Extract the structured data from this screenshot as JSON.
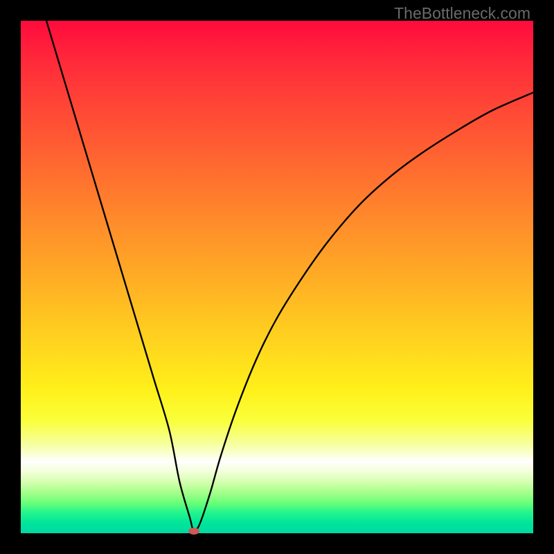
{
  "watermark": "TheBottleneck.com",
  "chart_data": {
    "type": "line",
    "title": "",
    "xlabel": "",
    "ylabel": "",
    "xlim": [
      0,
      100
    ],
    "ylim": [
      0,
      100
    ],
    "grid": false,
    "legend": false,
    "series": [
      {
        "name": "curve",
        "color": "#000000",
        "x": [
          5,
          8,
          11,
          14,
          17,
          20,
          23,
          26,
          29,
          31,
          33,
          33.5,
          34,
          35,
          37,
          39,
          42,
          46,
          50,
          55,
          60,
          66,
          72,
          78,
          85,
          92,
          100
        ],
        "y": [
          100,
          90,
          80,
          70,
          60,
          50,
          40,
          30,
          20,
          10,
          3,
          1,
          0.5,
          2,
          8,
          15,
          24,
          34,
          42,
          50,
          57,
          64,
          69.5,
          74,
          78.5,
          82.5,
          86
        ]
      }
    ],
    "marker": {
      "x": 33.8,
      "y": 0.4,
      "color": "#cc5a56"
    },
    "background_gradient": {
      "top": "#ff0b3c",
      "mid": "#ffe41c",
      "bottom": "#00d9a4"
    }
  }
}
